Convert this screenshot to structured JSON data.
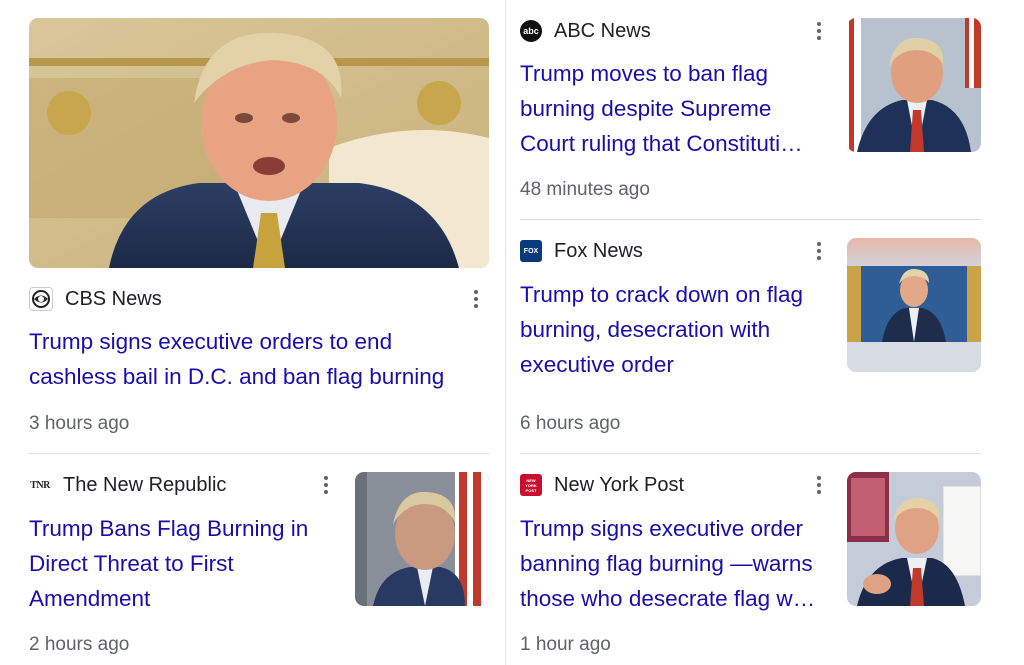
{
  "articles": [
    {
      "source": "CBS News",
      "source_icon": "cbs-eye-icon",
      "headline": "Trump signs executive orders to end cashless bail in D.C. and ban flag burning",
      "time": "3 hours ago"
    },
    {
      "source": "ABC News",
      "source_icon": "abc-logo-icon",
      "headline": "Trump moves to ban flag burning despite Supreme Court ruling that Constituti…",
      "time": "48 minutes ago"
    },
    {
      "source": "Fox News",
      "source_icon": "fox-logo-icon",
      "headline": "Trump to crack down on flag burning, desecration with executive order",
      "time": "6 hours ago"
    },
    {
      "source": "The New Republic",
      "source_icon": "tnr-logo-icon",
      "headline": "Trump Bans Flag Burning in Direct Threat to First Amendment",
      "time": "2 hours ago"
    },
    {
      "source": "New York Post",
      "source_icon": "nypost-logo-icon",
      "headline": "Trump signs executive order banning flag burning —warns those who desecrate flag w…",
      "time": "1 hour ago"
    }
  ],
  "logos": {
    "abc": "abc",
    "tnr": "TNR",
    "nyp": "NEW YORK POST",
    "fox": "FOX"
  },
  "colors": {
    "headline": "#1a0dab",
    "meta": "#5f6368",
    "divider": "#dadce0"
  }
}
